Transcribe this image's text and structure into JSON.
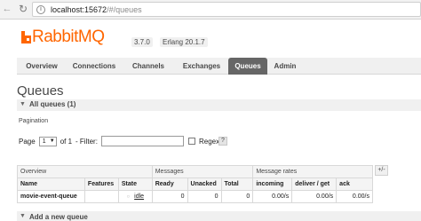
{
  "browser": {
    "url_host": "localhost:15672",
    "url_path": "/#/queues"
  },
  "header": {
    "logo_text": "RabbitMQ",
    "version": "3.7.0",
    "erlang": "Erlang 20.1.7"
  },
  "tabs": [
    {
      "label": "Overview"
    },
    {
      "label": "Connections"
    },
    {
      "label": "Channels"
    },
    {
      "label": "Exchanges"
    },
    {
      "label": "Queues",
      "active": true
    },
    {
      "label": "Admin"
    }
  ],
  "page": {
    "title": "Queues",
    "section_label": "All queues (1)"
  },
  "pagination": {
    "label": "Pagination",
    "page_word": "Page",
    "page_value": "1",
    "of_text": "of 1",
    "filter_label": "- Filter:",
    "filter_value": "",
    "regex_label": "Regex",
    "help": "?"
  },
  "table": {
    "groups": [
      "Overview",
      "Messages",
      "Message rates"
    ],
    "plus_minus": "+/-",
    "columns": [
      "Name",
      "Features",
      "State",
      "Ready",
      "Unacked",
      "Total",
      "incoming",
      "deliver / get",
      "ack"
    ],
    "rows": [
      {
        "name": "movie-event-queue",
        "features": "",
        "state": "idle",
        "ready": "0",
        "unacked": "0",
        "total": "0",
        "incoming": "0.00/s",
        "deliver_get": "0.00/s",
        "ack": "0.00/s"
      }
    ]
  },
  "add_queue": {
    "label": "Add a new queue"
  },
  "colors": {
    "brand_orange": "#ff6600",
    "tab_active_bg": "#666666"
  }
}
